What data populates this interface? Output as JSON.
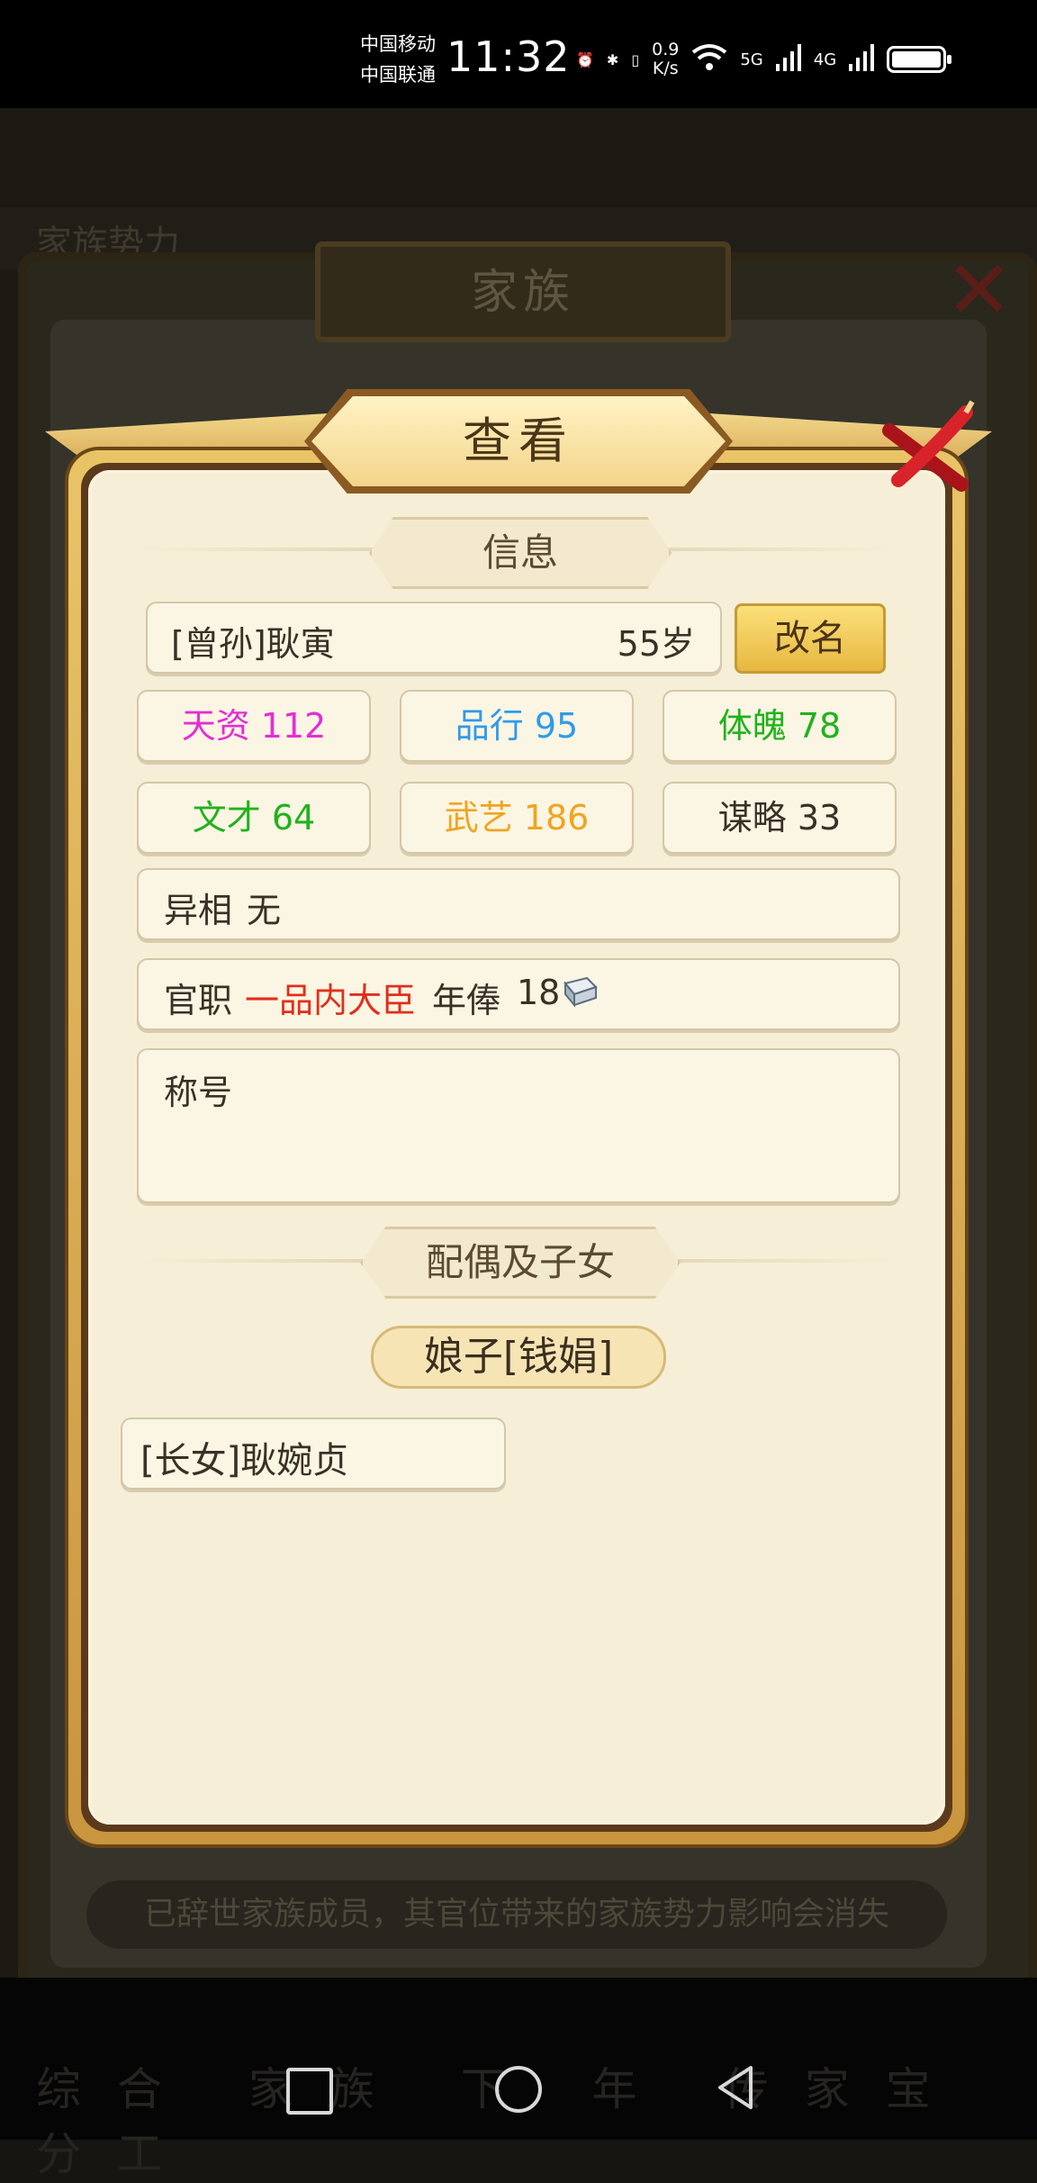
{
  "status_bar": {
    "carrier_1": "中国移动",
    "carrier_2": "中国联通",
    "time": "11:32",
    "net_speed_value": "0.9",
    "net_speed_unit": "K/s",
    "signal_1": "5G",
    "signal_2": "4G"
  },
  "background": {
    "power_label": "家族势力",
    "family_title": "家族",
    "notice": "已辞世家族成员，其官位带来的家族势力影响会消失",
    "tabs": "综合 家族 下 年 传家宝 分工"
  },
  "modal": {
    "title": "查看",
    "info_header": "信息",
    "member_name": "[曾孙]耿寅",
    "member_age": "55岁",
    "rename_label": "改名",
    "stats": [
      {
        "label": "天资",
        "value": "112",
        "color": "#e52dd3"
      },
      {
        "label": "品行",
        "value": "95",
        "color": "#2f9bea"
      },
      {
        "label": "体魄",
        "value": "78",
        "color": "#21b21d"
      },
      {
        "label": "文才",
        "value": "64",
        "color": "#21b21d"
      },
      {
        "label": "武艺",
        "value": "186",
        "color": "#f0a421"
      },
      {
        "label": "谋略",
        "value": "33",
        "color": "#3a3025"
      }
    ],
    "trait_label": "异相",
    "trait_value": "无",
    "office_label": "官职",
    "office_value": "一品内大臣",
    "salary_label": "年俸",
    "salary_value": "18",
    "title_label": "称号",
    "family_header": "配偶及子女",
    "spouse": "娘子[钱娟]",
    "children": [
      "[长女]耿婉贞"
    ]
  }
}
